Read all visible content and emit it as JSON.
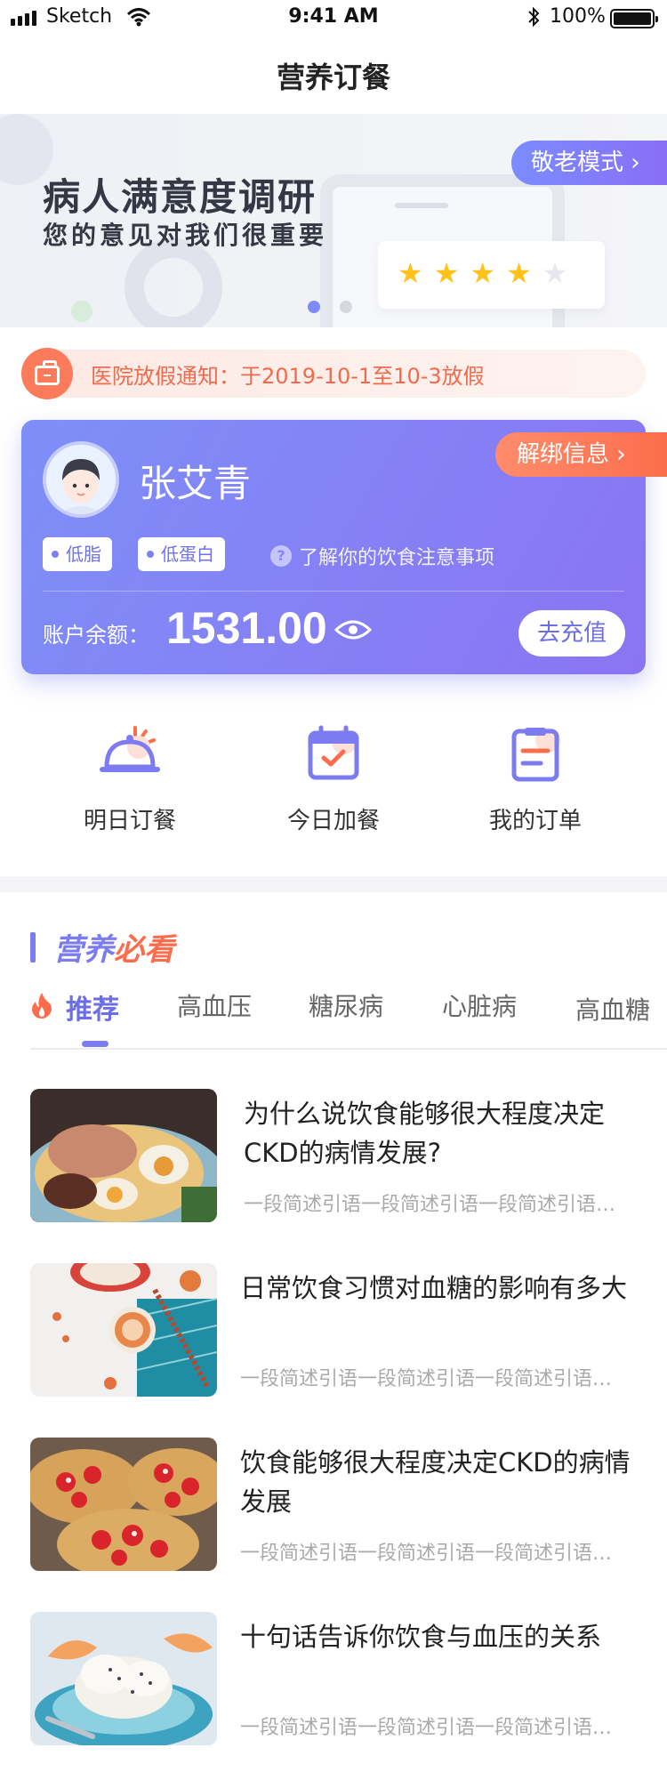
{
  "status_bar": {
    "carrier": "Sketch",
    "time": "9:41 AM",
    "battery": "100%"
  },
  "nav": {
    "title": "营养订餐"
  },
  "banner": {
    "title": "病人满意度调研",
    "subtitle": "您的意见对我们很重要",
    "elder_mode_label": "敬老模式",
    "rating_stars": 4,
    "rating_max": 5,
    "slides": 2,
    "active_slide": 1
  },
  "notice": {
    "text": "医院放假通知：于2019-10-1至10-3放假"
  },
  "user": {
    "name": "张艾青",
    "unbind_label": "解绑信息",
    "tags": [
      "低脂",
      "低蛋白"
    ],
    "diet_link": "了解你的饮食注意事项",
    "balance_label": "账户余额：",
    "balance_value": "1531.00",
    "recharge_label": "去充值"
  },
  "quick_actions": [
    {
      "label": "明日订餐",
      "icon": "dome-cloche-icon"
    },
    {
      "label": "今日加餐",
      "icon": "calendar-check-icon"
    },
    {
      "label": "我的订单",
      "icon": "order-list-icon"
    }
  ],
  "section": {
    "title_part1": "营养",
    "title_part2": "必看"
  },
  "tabs": [
    "推荐",
    "高血压",
    "糖尿病",
    "心脏病",
    "高血糖"
  ],
  "articles": [
    {
      "title": "为什么说饮食能够很大程度决定CKD的病情发展?",
      "desc": "一段简述引语一段简述引语一段简述引语一段简述引语"
    },
    {
      "title": "日常饮食习惯对血糖的影响有多大",
      "desc": "一段简述引语一段简述引语一段简述引语一段简述引语"
    },
    {
      "title": "饮食能够很大程度决定CKD的病情发展",
      "desc": "一段简述引语一段简述引语一段简述引语一段简述引语"
    },
    {
      "title": "十句话告诉你饮食与血压的关系",
      "desc": "一段简述引语一段简述引语一段简述引语一段简述引语"
    }
  ],
  "colors": {
    "primary": "#7c7cf0",
    "accent_orange": "#fb6d4c",
    "star": "#ffc21a"
  }
}
